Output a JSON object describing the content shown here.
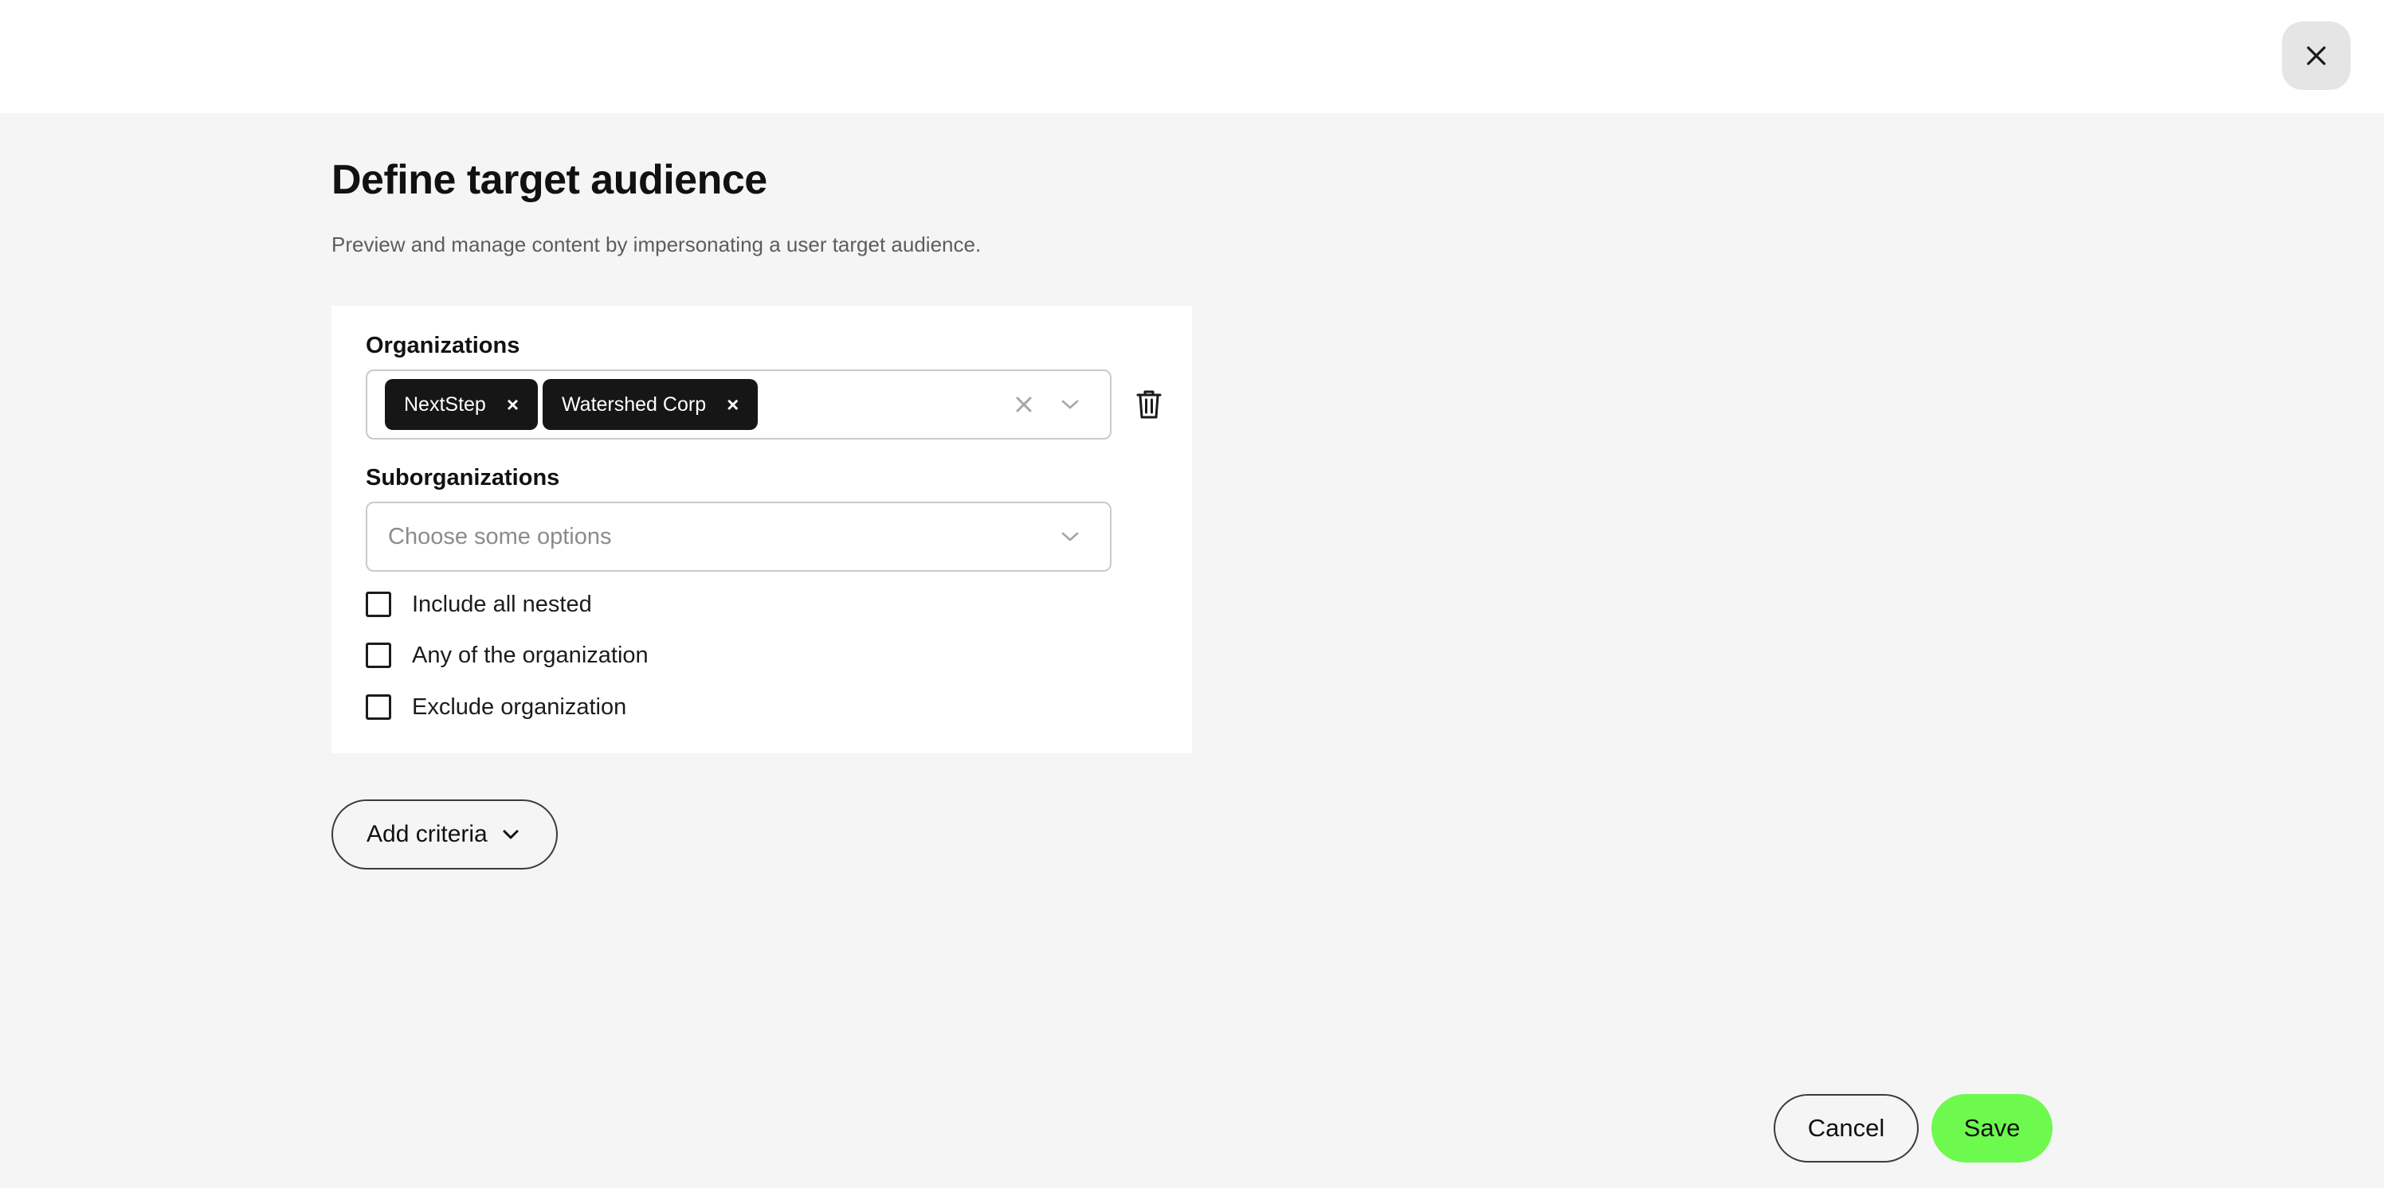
{
  "header": {
    "close_icon": "close-icon"
  },
  "page": {
    "title": "Define target audience",
    "subtitle": "Preview and manage content by impersonating a user target audience."
  },
  "criteria": {
    "organizations": {
      "label": "Organizations",
      "selected": [
        "NextStep",
        "Watershed Corp"
      ],
      "chip_remove_glyph": "×",
      "clear_icon": "clear-icon",
      "dropdown_icon": "chevron-down-icon",
      "delete_icon": "trash-icon"
    },
    "suborganizations": {
      "label": "Suborganizations",
      "placeholder": "Choose some options",
      "dropdown_icon": "chevron-down-icon"
    },
    "options": [
      {
        "label": "Include all nested",
        "checked": false
      },
      {
        "label": "Any of the organization",
        "checked": false
      },
      {
        "label": "Exclude organization",
        "checked": false
      }
    ]
  },
  "actions": {
    "add_criteria_label": "Add criteria",
    "cancel_label": "Cancel",
    "save_label": "Save"
  },
  "colors": {
    "page_background": "#f4f5f4",
    "chip_background": "#161616",
    "save_accent": "#6ef94f"
  }
}
